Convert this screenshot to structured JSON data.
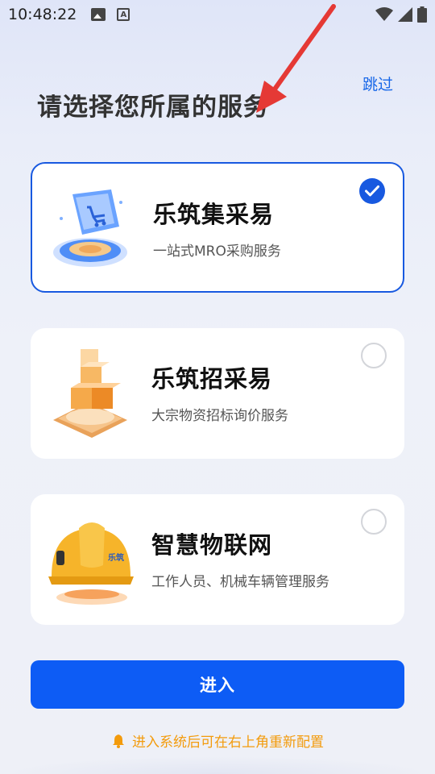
{
  "status_bar": {
    "time": "10:48:22",
    "left_icons": [
      "image-icon",
      "a-icon"
    ],
    "right_icons": [
      "wifi-icon",
      "signal-icon",
      "battery-icon"
    ]
  },
  "header": {
    "skip_label": "跳过",
    "title": "请选择您所属的服务"
  },
  "services": [
    {
      "title": "乐筑集采易",
      "desc": "一站式MRO采购服务",
      "icon": "shopping-cart-screen-icon",
      "selected": true
    },
    {
      "title": "乐筑招采易",
      "desc": "大宗物资招标询价服务",
      "icon": "cube-stack-icon",
      "selected": false
    },
    {
      "title": "智慧物联网",
      "desc": "工作人员、机械车辆管理服务",
      "icon": "safety-helmet-icon",
      "selected": false
    }
  ],
  "enter_button": {
    "label": "进入"
  },
  "hint": {
    "text": "进入系统后可在右上角重新配置",
    "icon": "bell-icon"
  },
  "colors": {
    "accent": "#0d5cf5",
    "hint": "#f39b0c",
    "annotation_arrow": "#e53935"
  }
}
